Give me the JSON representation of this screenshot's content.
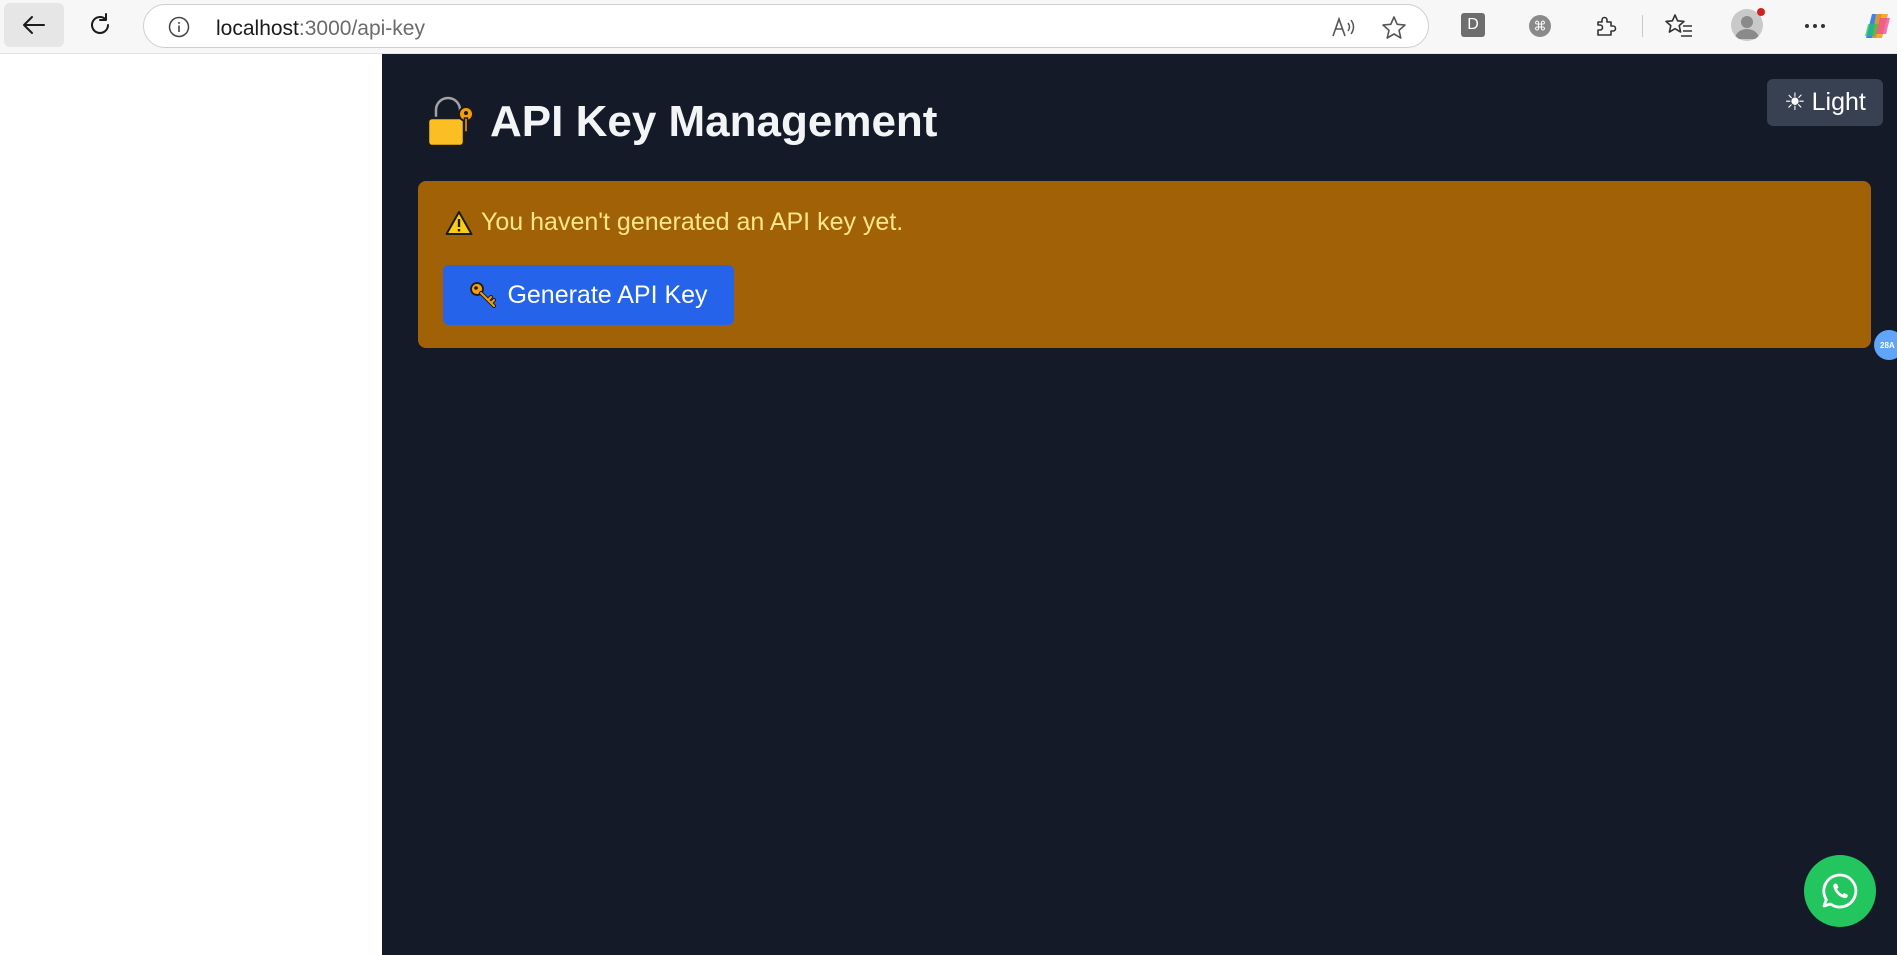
{
  "browser": {
    "url_host": "localhost",
    "url_path": ":3000/api-key",
    "extension_letter": "D",
    "icons": {
      "back": "back-arrow-icon",
      "reload": "reload-icon",
      "info": "site-info-icon",
      "read_aloud": "read-aloud-icon",
      "favorite": "favorite-star-icon",
      "extension_d": "extension-d-icon",
      "extension_cmd": "extension-command-icon",
      "extensions": "extensions-puzzle-icon",
      "favorites": "favorites-list-icon",
      "profile": "profile-avatar-icon",
      "more": "more-dots-icon",
      "copilot": "copilot-icon"
    }
  },
  "page": {
    "title": "API Key Management",
    "theme_toggle_label": "Light",
    "theme_toggle_icon": "☀",
    "warning_text": "You haven't generated an API key yet.",
    "generate_button_label": "Generate API Key",
    "side_badge_text": "28A",
    "icons": {
      "title": "lock-key-icon",
      "warning": "warning-triangle-icon",
      "generate": "key-icon",
      "whatsapp": "whatsapp-icon"
    }
  },
  "colors": {
    "page_background": "#141a28",
    "warning_background": "#a16207",
    "warning_text": "#fde68a",
    "primary_button": "#2563eb",
    "theme_button": "#374151",
    "whatsapp": "#22c55e",
    "side_badge": "#60a5fa"
  }
}
